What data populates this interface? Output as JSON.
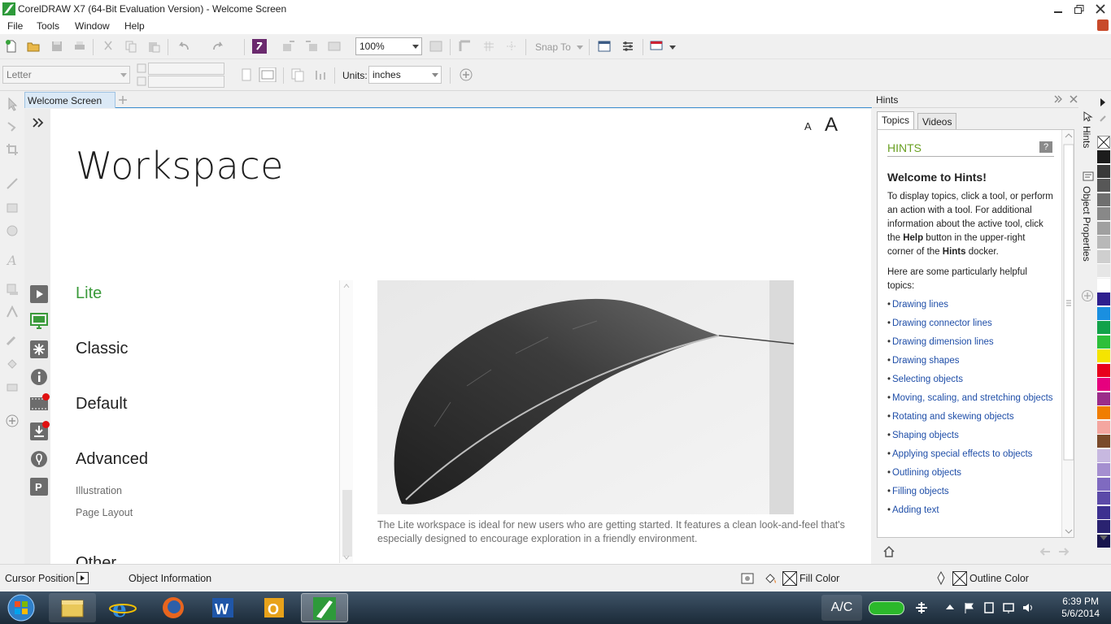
{
  "window": {
    "title": "CorelDRAW X7 (64-Bit Evaluation Version) - Welcome Screen"
  },
  "menu": [
    {
      "label": "File"
    },
    {
      "label": "Tools"
    },
    {
      "label": "Window"
    },
    {
      "label": "Help"
    }
  ],
  "toolbar1": {
    "zoom": "100%",
    "snap_to": "Snap To"
  },
  "toolbar2": {
    "page_size": "Letter",
    "units_label": "Units:",
    "units_value": "inches"
  },
  "tabs": {
    "document": "Welcome Screen"
  },
  "welcome": {
    "font_small": "A",
    "font_big": "A",
    "heading": "Workspace",
    "items": [
      "Lite",
      "Classic",
      "Default",
      "Advanced"
    ],
    "subitems": [
      "Illustration",
      "Page Layout"
    ],
    "cut_item": "Other",
    "description": "The Lite workspace is ideal for new users who are getting started. It features a clean look-and-feel that's especially designed to encourage exploration in a friendly environment."
  },
  "hints": {
    "docker_title": "Hints",
    "tab_topics": "Topics",
    "tab_videos": "Videos",
    "section_label": "HINTS",
    "welcome": "Welcome to Hints!",
    "para1_a": "To display topics, click a tool, or perform an action with a tool. For additional information about the active tool, click the ",
    "para1_help": "Help",
    "para1_b": " button in the upper-right corner of the ",
    "para1_hints": "Hints",
    "para1_c": " docker.",
    "para2": "Here are some particularly helpful topics:",
    "links": [
      "Drawing lines",
      "Drawing connector lines",
      "Drawing dimension lines",
      "Drawing shapes",
      "Selecting objects",
      "Moving, scaling, and stretching objects",
      "Rotating and skewing objects",
      "Shaping objects",
      "Applying special effects to objects",
      "Outlining objects",
      "Filling objects",
      "Adding text"
    ]
  },
  "docker_tabs": [
    "Hints",
    "Object Properties"
  ],
  "palette": [
    "#1c1c1c",
    "#3a3a3a",
    "#575757",
    "#6f6f6f",
    "#888888",
    "#a0a0a0",
    "#b8b8b8",
    "#cfcfcf",
    "#e6e6e6",
    "#ffffff",
    "#2e1f8e",
    "#1a8fe0",
    "#12a24a",
    "#2dbf3a",
    "#f5e400",
    "#e8001c",
    "#e6007e",
    "#9b2c8a",
    "#f07d00",
    "#f4a6a0",
    "#7a4a2a",
    "#c7b8e0",
    "#a58fd0",
    "#7f6ac0",
    "#5b4aa8",
    "#3c3090",
    "#2a2370",
    "#18154e"
  ],
  "status": {
    "cursor_position": "Cursor Position",
    "object_info": "Object Information",
    "fill_color": "Fill Color",
    "outline_color": "Outline Color"
  },
  "taskbar": {
    "ac": "A/C",
    "time": "6:39 PM",
    "date": "5/6/2014"
  }
}
